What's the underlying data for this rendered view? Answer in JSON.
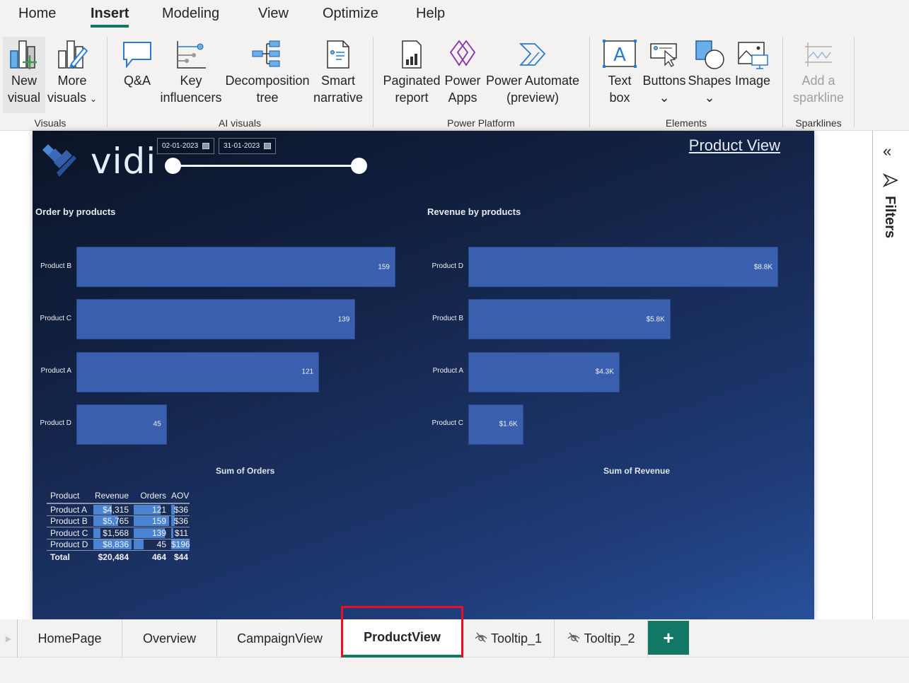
{
  "menu": {
    "tabs": [
      {
        "label": "Home"
      },
      {
        "label": "Insert",
        "active": true
      },
      {
        "label": "Modeling"
      },
      {
        "label": "View"
      },
      {
        "label": "Optimize"
      },
      {
        "label": "Help"
      }
    ]
  },
  "ribbon": {
    "new_visual": {
      "line1": "New",
      "line2": "visual"
    },
    "more_visuals": {
      "line1": "More",
      "line2": "visuals"
    },
    "qa": {
      "line1": "Q&A"
    },
    "key_influencers": {
      "line1": "Key",
      "line2": "influencers"
    },
    "decomposition_tree": {
      "line1": "Decomposition",
      "line2": "tree"
    },
    "smart_narrative": {
      "line1": "Smart",
      "line2": "narrative"
    },
    "paginated_report": {
      "line1": "Paginated",
      "line2": "report"
    },
    "power_apps": {
      "line1": "Power",
      "line2": "Apps"
    },
    "power_automate": {
      "line1": "Power Automate",
      "line2": "(preview)"
    },
    "text_box": {
      "line1": "Text",
      "line2": "box"
    },
    "buttons": {
      "line1": "Buttons"
    },
    "shapes": {
      "line1": "Shapes"
    },
    "image": {
      "line1": "Image"
    },
    "sparkline": {
      "line1": "Add a",
      "line2": "sparkline"
    },
    "groups": {
      "visuals": "Visuals",
      "ai_visuals": "AI visuals",
      "power_platform": "Power Platform",
      "elements": "Elements",
      "sparklines": "Sparklines"
    },
    "chevron": "⌄"
  },
  "report": {
    "logo_text": "vidi",
    "date_start": "02-01-2023",
    "date_end": "31-01-2023",
    "date_slider_range": [
      0,
      1
    ],
    "page_title": "Product View",
    "colors": {
      "bar": "#3a5fae",
      "databar": "#4a83d1",
      "accent": "#117865"
    },
    "sum_of_orders_title": "Sum of Orders",
    "sum_of_revenue_title": "Sum of Revenue",
    "table": {
      "headers": [
        "Product",
        "Revenue",
        "Orders",
        "AOV"
      ],
      "rows": [
        {
          "product": "Product A",
          "revenue": "$4,315",
          "orders": "121",
          "aov": "$36",
          "revenue_val": 4315,
          "orders_val": 121,
          "aov_val": 36
        },
        {
          "product": "Product B",
          "revenue": "$5,765",
          "orders": "159",
          "aov": "$36",
          "revenue_val": 5765,
          "orders_val": 159,
          "aov_val": 36
        },
        {
          "product": "Product C",
          "revenue": "$1,568",
          "orders": "139",
          "aov": "$11",
          "revenue_val": 1568,
          "orders_val": 139,
          "aov_val": 11
        },
        {
          "product": "Product D",
          "revenue": "$8,836",
          "orders": "45",
          "aov": "$196",
          "revenue_val": 8836,
          "orders_val": 45,
          "aov_val": 196
        }
      ],
      "total": {
        "product": "Total",
        "revenue": "$20,484",
        "orders": "464",
        "aov": "$44"
      }
    }
  },
  "chart_data": [
    {
      "type": "bar",
      "orientation": "horizontal",
      "title": "Order by products",
      "categories": [
        "Product B",
        "Product C",
        "Product A",
        "Product D"
      ],
      "values": [
        159,
        139,
        121,
        45
      ],
      "labels": [
        "159",
        "139",
        "121",
        "45"
      ],
      "xlabel": "",
      "ylabel": "",
      "xlim": [
        0,
        159
      ],
      "grid": false
    },
    {
      "type": "bar",
      "orientation": "horizontal",
      "title": "Revenue by products",
      "categories": [
        "Product D",
        "Product B",
        "Product A",
        "Product C"
      ],
      "values": [
        8836,
        5765,
        4315,
        1568
      ],
      "labels": [
        "$8.8K",
        "$5.8K",
        "$4.3K",
        "$1.6K"
      ],
      "xlabel": "",
      "ylabel": "",
      "xlim": [
        0,
        8836
      ],
      "grid": false
    }
  ],
  "filters": {
    "collapse_icon": "«",
    "label": "Filters"
  },
  "page_tabs": {
    "tabs": [
      {
        "label": "HomePage",
        "hidden": false
      },
      {
        "label": "Overview",
        "hidden": false
      },
      {
        "label": "CampaignView",
        "hidden": false
      },
      {
        "label": "ProductView",
        "hidden": false,
        "active": true
      },
      {
        "label": "Tooltip_1",
        "hidden": true
      },
      {
        "label": "Tooltip_2",
        "hidden": true
      }
    ],
    "add_label": "+"
  }
}
